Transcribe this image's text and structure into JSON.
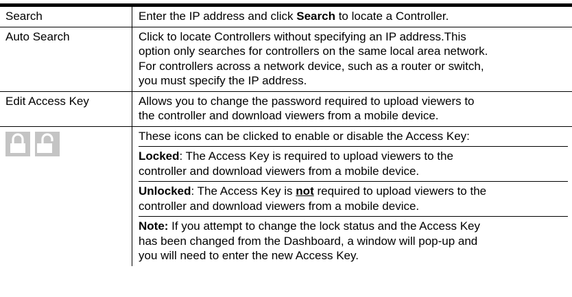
{
  "rows": [
    {
      "term": "Search",
      "desc_pre": "Enter the IP address and click ",
      "desc_bold": "Search",
      "desc_post": " to locate a Controller."
    },
    {
      "term": "Auto Search",
      "line1": "Click to locate Controllers without specifying an IP address.This",
      "line2": "option only searches for controllers on the same local area network.",
      "line3": "For controllers across a network device, such as a router or switch,",
      "line4": "you must specify the IP address."
    },
    {
      "term": "Edit Access Key",
      "line1": "Allows you to change the password required to upload viewers to",
      "line2": "the controller and download viewers from a mobile device."
    }
  ],
  "icons_row": {
    "icons": [
      "lock-icon",
      "unlock-icon"
    ],
    "icon_color": "#c4c4c4",
    "intro": "These icons can be clicked to enable or disable the Access Key:",
    "locked_label": "Locked",
    "locked_line1": ": The Access Key is required to upload viewers to the",
    "locked_line2": "controller and download viewers from a mobile device.",
    "unlocked_label": "Unlocked",
    "unlocked_mid1": ": The Access Key is ",
    "unlocked_not": "not",
    "unlocked_mid2": " required to upload viewers to the",
    "unlocked_line2": "controller and download viewers from a mobile device.",
    "note_label": "Note:",
    "note_line1": " If you attempt to change the lock status and the Access Key",
    "note_line2": "has been changed from the Dashboard, a window will pop-up and",
    "note_line3": "you will need to enter the new Access Key."
  }
}
